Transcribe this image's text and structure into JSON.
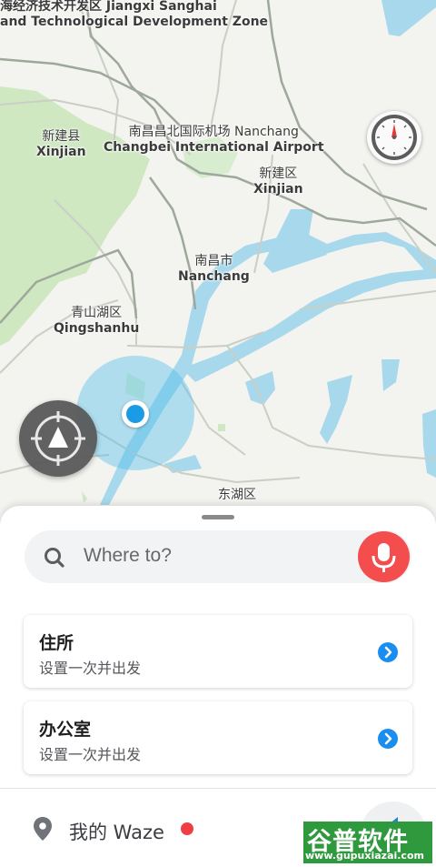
{
  "map": {
    "labels": {
      "zone": {
        "zh": "海经济技术开发区 Jiangxi Sanghai",
        "en": "and Technological Development Zone"
      },
      "xinjian_county": {
        "zh": "新建县",
        "en": "Xinjian"
      },
      "airport": {
        "zh": "南昌昌北国际机场 Nanchang",
        "en": "Changbei International Airport"
      },
      "xinjian_district": {
        "zh": "新建区",
        "en": "Xinjian"
      },
      "nanchang": {
        "zh": "南昌市",
        "en": "Nanchang"
      },
      "qingshanhu": {
        "zh": "青山湖区",
        "en": "Qingshanhu"
      },
      "donghu": {
        "zh": "东湖区"
      }
    },
    "colors": {
      "water": "#a8d8ec",
      "park": "#cfe8c2",
      "location": "#1a9be6"
    }
  },
  "compass": {
    "icon": "compass-icon"
  },
  "recenter": {
    "icon": "recenter-icon"
  },
  "search": {
    "placeholder": "Where to?",
    "icon": "search-icon",
    "mic_icon": "microphone-icon",
    "mic_color": "#f34d4d"
  },
  "places": [
    {
      "title": "住所",
      "subtitle": "设置一次并出发"
    },
    {
      "title": "办公室",
      "subtitle": "设置一次并出发"
    }
  ],
  "footer": {
    "label": "我的 Waze",
    "notification_color": "#ef3f45"
  },
  "watermark": {
    "title": "谷普软件园",
    "url": "www.gupuxiazai.com"
  }
}
